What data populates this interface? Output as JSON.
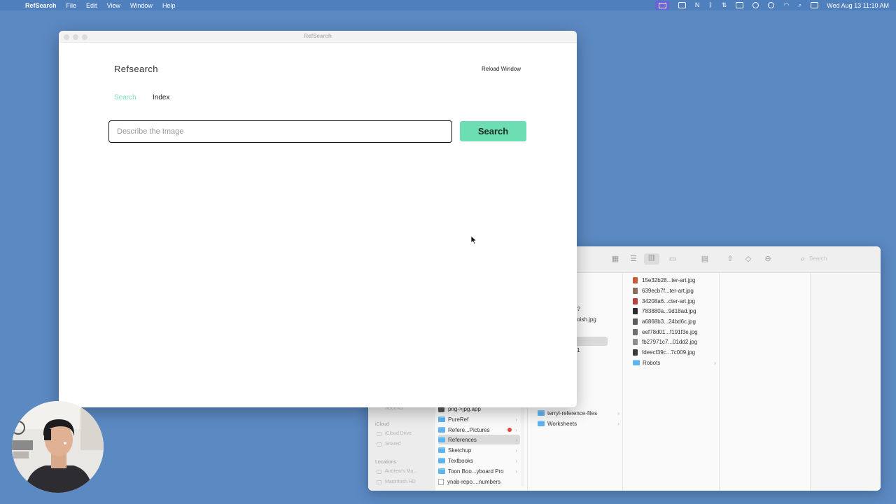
{
  "menubar": {
    "apple_glyph": "",
    "items": [
      "RefSearch",
      "File",
      "Edit",
      "View",
      "Window",
      "Help"
    ],
    "clock": "Wed Aug 13  11:10 AM",
    "status_glyphs": {
      "notion": "N",
      "bluetooth": "ᛒ",
      "sync": "⇅",
      "wifi": "◠",
      "search": "⌕"
    }
  },
  "app_window": {
    "window_title": "RefSearch",
    "app_title": "Refsearch",
    "reload_label": "Reload Window",
    "tabs": [
      {
        "label": "Search",
        "active": true
      },
      {
        "label": "Index",
        "active": false
      }
    ],
    "search": {
      "placeholder": "Describe the Image",
      "value": "",
      "button_label": "Search"
    },
    "colors": {
      "accent": "#6cdeb1",
      "active_tab": "#7fe0bf"
    }
  },
  "finder": {
    "sidebar": {
      "sections": [
        {
          "heading": "iCloud",
          "items": [
            "iCloud Drive",
            "Shared"
          ]
        },
        {
          "heading": "Locations",
          "items": [
            "Andrew's Ma...",
            "Macintosh HD"
          ]
        }
      ],
      "top_fragment": "Recents"
    },
    "column1": [
      {
        "name": "png->jpg.app",
        "icon": "app"
      },
      {
        "name": "PureRef",
        "icon": "folder"
      },
      {
        "name": "Refere...Pictures",
        "icon": "folder",
        "tag": "red"
      },
      {
        "name": "References",
        "icon": "folder",
        "selected": true
      },
      {
        "name": "Sketchup",
        "icon": "folder"
      },
      {
        "name": "Textbooks",
        "icon": "folder"
      },
      {
        "name": "Toon Boo...yboard Pro",
        "icon": "folder"
      },
      {
        "name": "ynab-repo....numbers",
        "icon": "doc"
      }
    ],
    "column2_fragments": [
      "es?",
      "_loish.jpg",
      "1"
    ],
    "column2": [
      {
        "name": "terryl-reference-files",
        "icon": "folder"
      },
      {
        "name": "Worksheets",
        "icon": "folder"
      }
    ],
    "column3": [
      {
        "name": "15e32b28...ter-art.jpg",
        "icon": "image",
        "color": "#c65b3c"
      },
      {
        "name": "639ecb7f...ter-art.jpg",
        "icon": "image",
        "color": "#8a6f5e"
      },
      {
        "name": "34208a6...cter-art.jpg",
        "icon": "image",
        "color": "#b5423a"
      },
      {
        "name": "783880a...9d18ad.jpg",
        "icon": "image",
        "color": "#2b2b2b"
      },
      {
        "name": "a6868b3...24bd6c.jpg",
        "icon": "image",
        "color": "#5c5c5c"
      },
      {
        "name": "eef78d01...f191f3e.jpg",
        "icon": "image",
        "color": "#6f6f6f"
      },
      {
        "name": "fb27971c7...01dd2.jpg",
        "icon": "image",
        "color": "#8e8e8e"
      },
      {
        "name": "fdeecf39c...7c009.jpg",
        "icon": "image",
        "color": "#3a3a3a"
      },
      {
        "name": "Robots",
        "icon": "folder"
      }
    ],
    "toolbar_search_placeholder": "Search"
  }
}
